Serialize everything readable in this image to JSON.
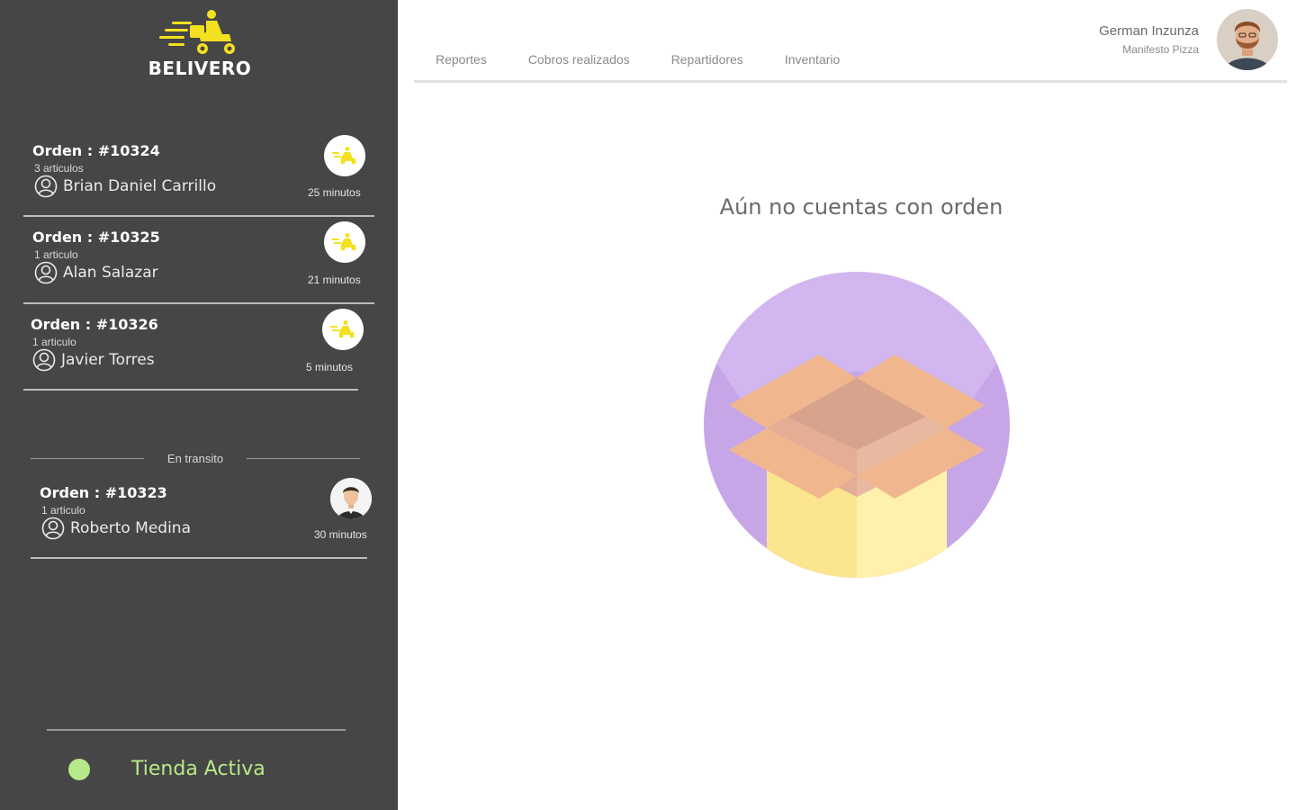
{
  "brand": {
    "name": "BELIVERO",
    "accent": "#f3e11f"
  },
  "sidebar": {
    "background": "#464646",
    "pending_orders": [
      {
        "title": "Orden : #10324",
        "items": "3 articulos",
        "customer": "Brian Daniel Carrillo",
        "time": "25 minutos",
        "icon": "scooter-icon"
      },
      {
        "title": "Orden : #10325",
        "items": "1 articulo",
        "customer": "Alan Salazar",
        "time": "21 minutos",
        "icon": "scooter-icon"
      },
      {
        "title": "Orden : #10326",
        "items": "1 articulo",
        "customer": "Javier Torres",
        "time": "5 minutos",
        "icon": "scooter-icon"
      }
    ],
    "transit_label": "En transito",
    "transit_orders": [
      {
        "title": "Orden : #10323",
        "items": "1 articulo",
        "customer": "Roberto Medina",
        "time": "30 minutos",
        "icon": "driver-avatar"
      }
    ],
    "store_status": {
      "label": "Tienda Activa",
      "color": "#b7e98a"
    }
  },
  "header": {
    "tabs": [
      "Reportes",
      "Cobros realizados",
      "Repartidores",
      "Inventario"
    ],
    "user": {
      "name": "German Inzunza",
      "store": "Manifesto Pizza"
    }
  },
  "main": {
    "empty_message": "Aún no cuentas con orden",
    "illustration": "empty-box-icon"
  }
}
